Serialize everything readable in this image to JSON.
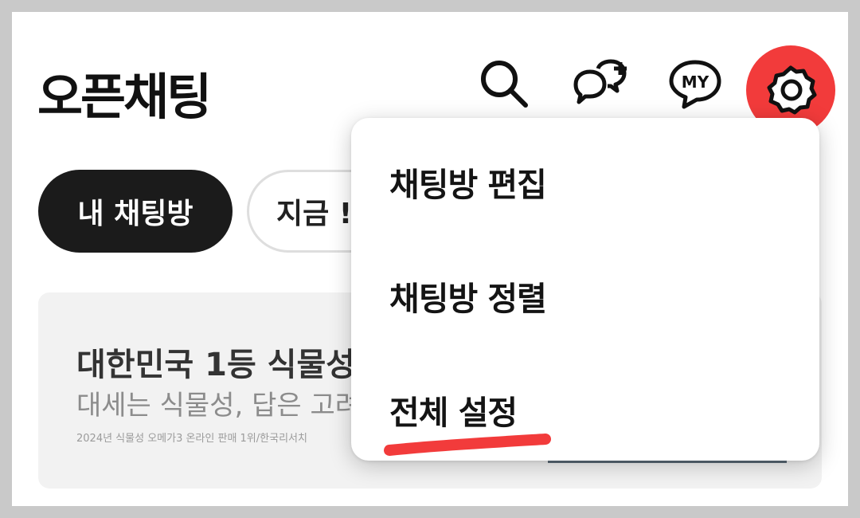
{
  "header": {
    "title": "오픈채팅",
    "icons": [
      "search-icon",
      "new-chat-icon",
      "my-chat-icon",
      "settings-gear-icon"
    ],
    "my_icon_text": "MY"
  },
  "tabs": [
    {
      "label": "내 채팅방",
      "active": true
    },
    {
      "label": "지금 !",
      "active": false
    }
  ],
  "banner": {
    "title": "대한민국 1등 식물성",
    "subtitle": "대세는 식물성, 답은 고려",
    "fine_print": "2024년 식물성 오메가3 온라인 판매 1위/한국리서치"
  },
  "menu": {
    "items": [
      "채팅방 편집",
      "채팅방 정렬",
      "전체 설정"
    ]
  },
  "colors": {
    "highlight": "#f23b3b",
    "active_chip": "#1b1b1b",
    "menu_bg": "#ffffff"
  }
}
